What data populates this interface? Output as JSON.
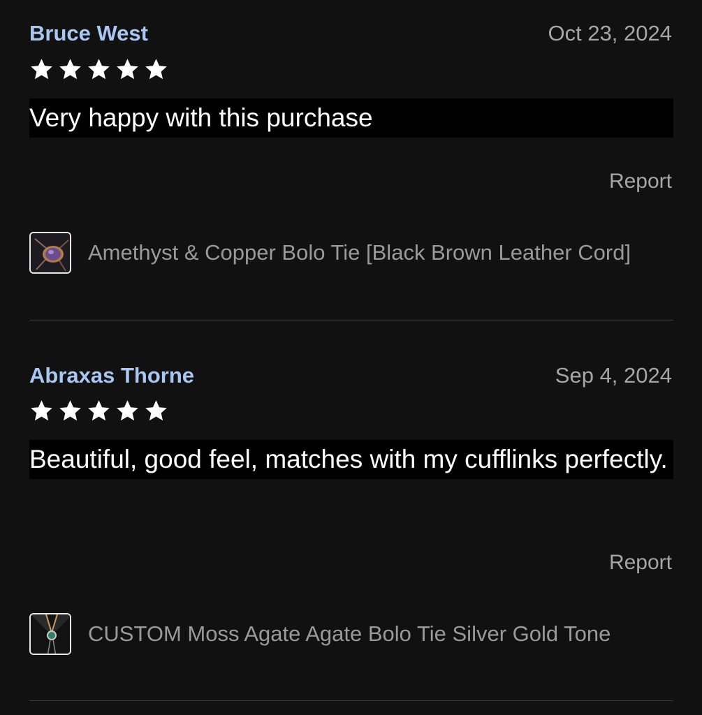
{
  "reviews": [
    {
      "reviewer": "Bruce West",
      "date": "Oct 23, 2024",
      "rating": 5,
      "text": "Very happy with this purchase",
      "report_label": "Report",
      "product": {
        "title": "Amethyst & Copper Bolo Tie [Black Brown Leather Cord]"
      }
    },
    {
      "reviewer": "Abraxas Thorne",
      "date": "Sep 4, 2024",
      "rating": 5,
      "text": "Beautiful, good feel, matches with my cufflinks perfectly.",
      "report_label": "Report",
      "product": {
        "title": "CUSTOM Moss Agate Agate Bolo Tie Silver Gold Tone"
      }
    }
  ],
  "colors": {
    "background": "#111111",
    "reviewer_name": "#a9c7f2",
    "secondary_text": "#a6a6a6",
    "review_text_bg": "#000000",
    "star": "#ffffff"
  }
}
